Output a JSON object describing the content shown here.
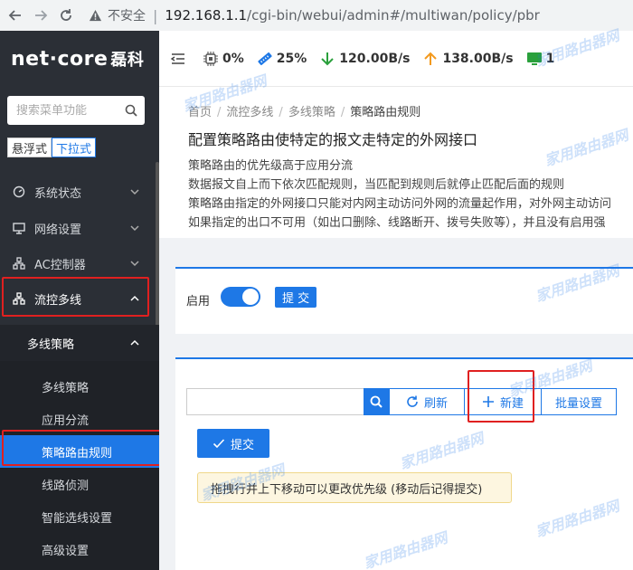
{
  "browser": {
    "insecure_label": "不安全",
    "url_host": "192.168.1.1",
    "url_path": "/cgi-bin/webui/admin#/multiwan/policy/pbr"
  },
  "sidebar": {
    "logo_text": "net·core",
    "logo_cn": "磊科",
    "search_placeholder": "搜索菜单功能",
    "mode_float": "悬浮式",
    "mode_dropdown": "下拉式",
    "menu": [
      {
        "label": "系统状态"
      },
      {
        "label": "网络设置"
      },
      {
        "label": "AC控制器"
      },
      {
        "label": "流控多线"
      }
    ],
    "submenu_title": "多线策略",
    "submenu": [
      {
        "label": "多线策略"
      },
      {
        "label": "应用分流"
      },
      {
        "label": "策略路由规则"
      },
      {
        "label": "线路侦测"
      },
      {
        "label": "智能选线设置"
      },
      {
        "label": "高级设置"
      }
    ]
  },
  "topbar": {
    "cpu": "0%",
    "mem": "25%",
    "down": "120.00B/s",
    "up": "138.00B/s",
    "screens": "1"
  },
  "page": {
    "crumbs": [
      "首页",
      "流控多线",
      "多线策略",
      "策略路由规则"
    ],
    "title": "配置策略路由使特定的报文走特定的外网接口",
    "desc": [
      "策略路由的优先级高于应用分流",
      "数据报文自上而下依次匹配规则，当匹配到规则后就停止匹配后面的规则",
      "策略路由指定的外网接口只能对内网主动访问外网的流量起作用，对外网主动访问",
      "如果指定的出口不可用（如出口删除、线路断开、拨号失败等），并且没有启用强"
    ]
  },
  "enable_card": {
    "enable_label": "启用",
    "submit_label": "提 交"
  },
  "rules_card": {
    "search_value": "",
    "refresh_label": "刷新",
    "new_label": "新建",
    "batch_label": "批量设置",
    "submit_label": "提交",
    "tip": "拖拽行并上下移动可以更改优先级 (移动后记得提交)"
  },
  "watermark": "家用路由器网",
  "colors": {
    "accent": "#1e78e6",
    "sidebar": "#2b2f36",
    "highlight": "#e02020"
  }
}
